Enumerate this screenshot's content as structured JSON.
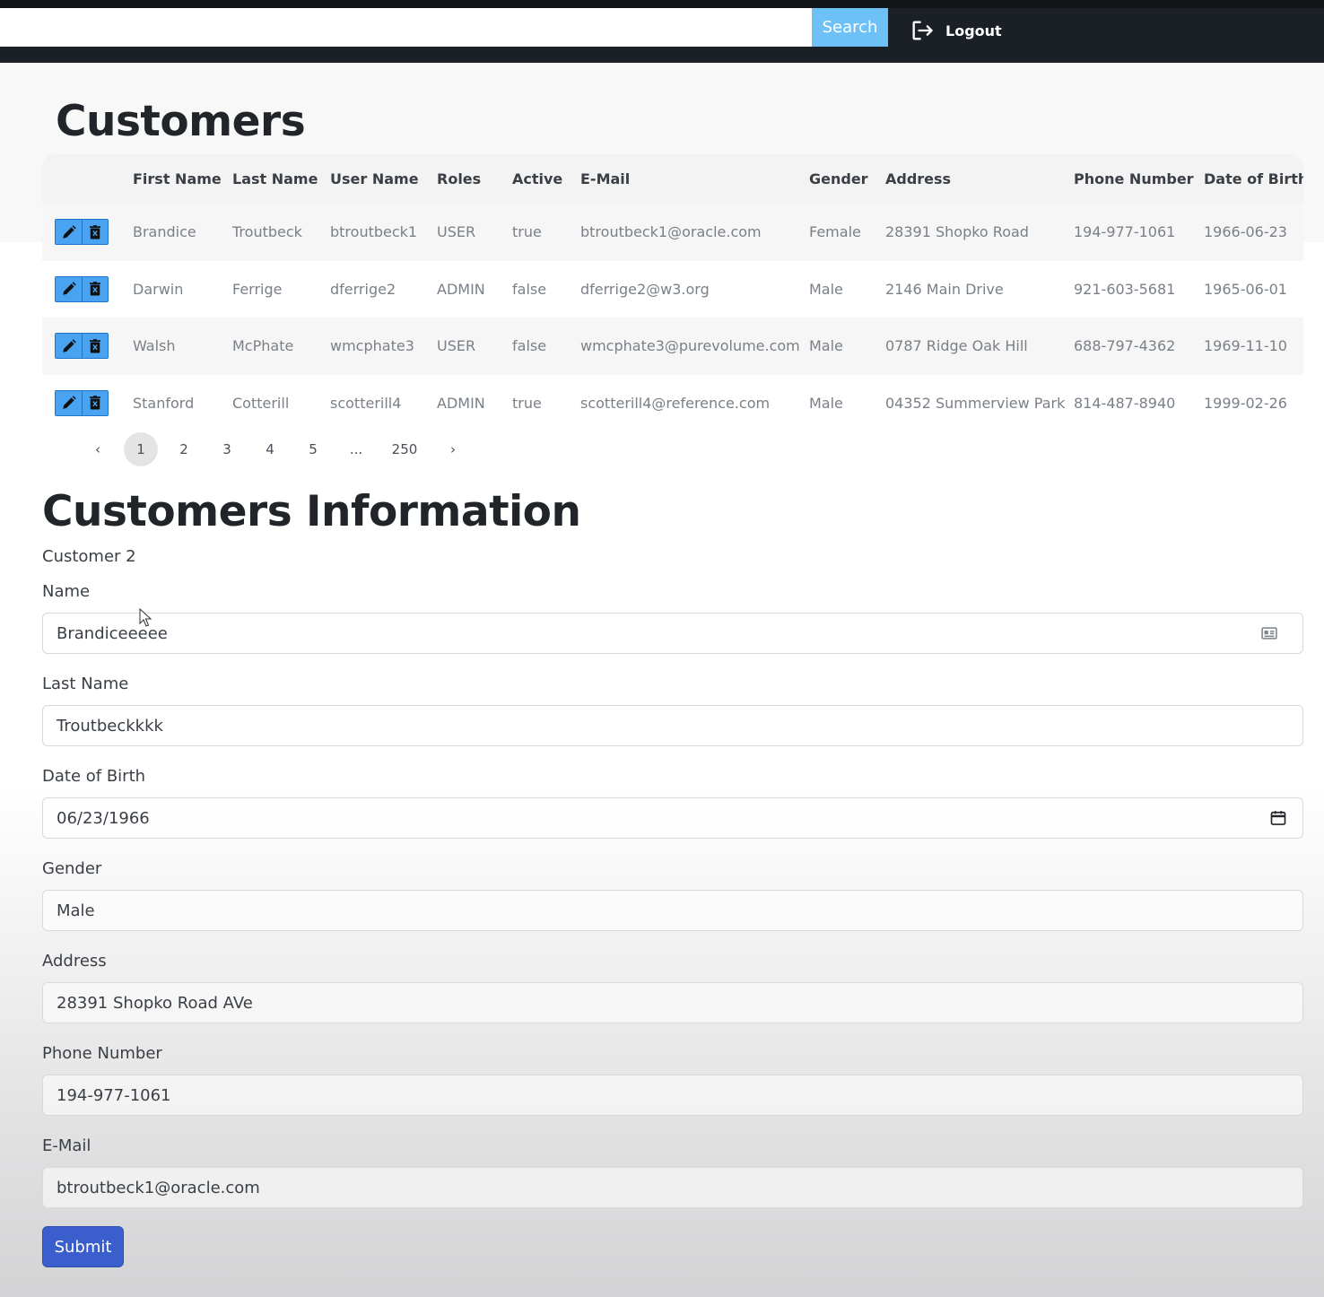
{
  "navbar": {
    "search_value": "",
    "search_label": "Search",
    "logout_label": "Logout"
  },
  "customers": {
    "title": "Customers",
    "columns": [
      "First Name",
      "Last Name",
      "User Name",
      "Roles",
      "Active",
      "E-Mail",
      "Gender",
      "Address",
      "Phone Number",
      "Date of Birth"
    ],
    "rows": [
      [
        "Brandice",
        "Troutbeck",
        "btroutbeck1",
        "USER",
        "true",
        "btroutbeck1@oracle.com",
        "Female",
        "28391 Shopko Road",
        "194-977-1061",
        "1966-06-23"
      ],
      [
        "Darwin",
        "Ferrige",
        "dferrige2",
        "ADMIN",
        "false",
        "dferrige2@w3.org",
        "Male",
        "2146 Main Drive",
        "921-603-5681",
        "1965-06-01"
      ],
      [
        "Walsh",
        "McPhate",
        "wmcphate3",
        "USER",
        "false",
        "wmcphate3@purevolume.com",
        "Male",
        "0787 Ridge Oak Hill",
        "688-797-4362",
        "1969-11-10"
      ],
      [
        "Stanford",
        "Cotterill",
        "scotterill4",
        "ADMIN",
        "true",
        "scotterill4@reference.com",
        "Male",
        "04352 Summerview Park",
        "814-487-8940",
        "1999-02-26"
      ]
    ]
  },
  "pagination": {
    "prev": "‹",
    "pages": [
      "1",
      "2",
      "3",
      "4",
      "5",
      "...",
      "250"
    ],
    "active_index": 0,
    "next": "›"
  },
  "form": {
    "title": "Customers Information",
    "customer_label": "Customer 2",
    "name_label": "Name",
    "name_value": "Brandiceeeee",
    "last_name_label": "Last Name",
    "last_name_value": "Troutbeckkkk",
    "dob_label": "Date of Birth",
    "dob_value": "06/23/1966",
    "gender_label": "Gender",
    "gender_value": "Male",
    "address_label": "Address",
    "address_value": "28391 Shopko Road AVe",
    "phone_label": "Phone Number",
    "phone_value": "194-977-1061",
    "email_label": "E-Mail",
    "email_value": "btroutbeck1@oracle.com",
    "submit_label": "Submit"
  },
  "icons": {
    "logout": "logout-icon",
    "edit": "pencil-icon",
    "delete": "trash-icon",
    "contact_card": "contact-card-icon",
    "calendar": "calendar-icon"
  },
  "colors": {
    "navbar_bg": "#1b1f26",
    "search_button": "#6ec1f7",
    "action_button": "#4aa3f0",
    "submit_button": "#3a5fcd"
  }
}
